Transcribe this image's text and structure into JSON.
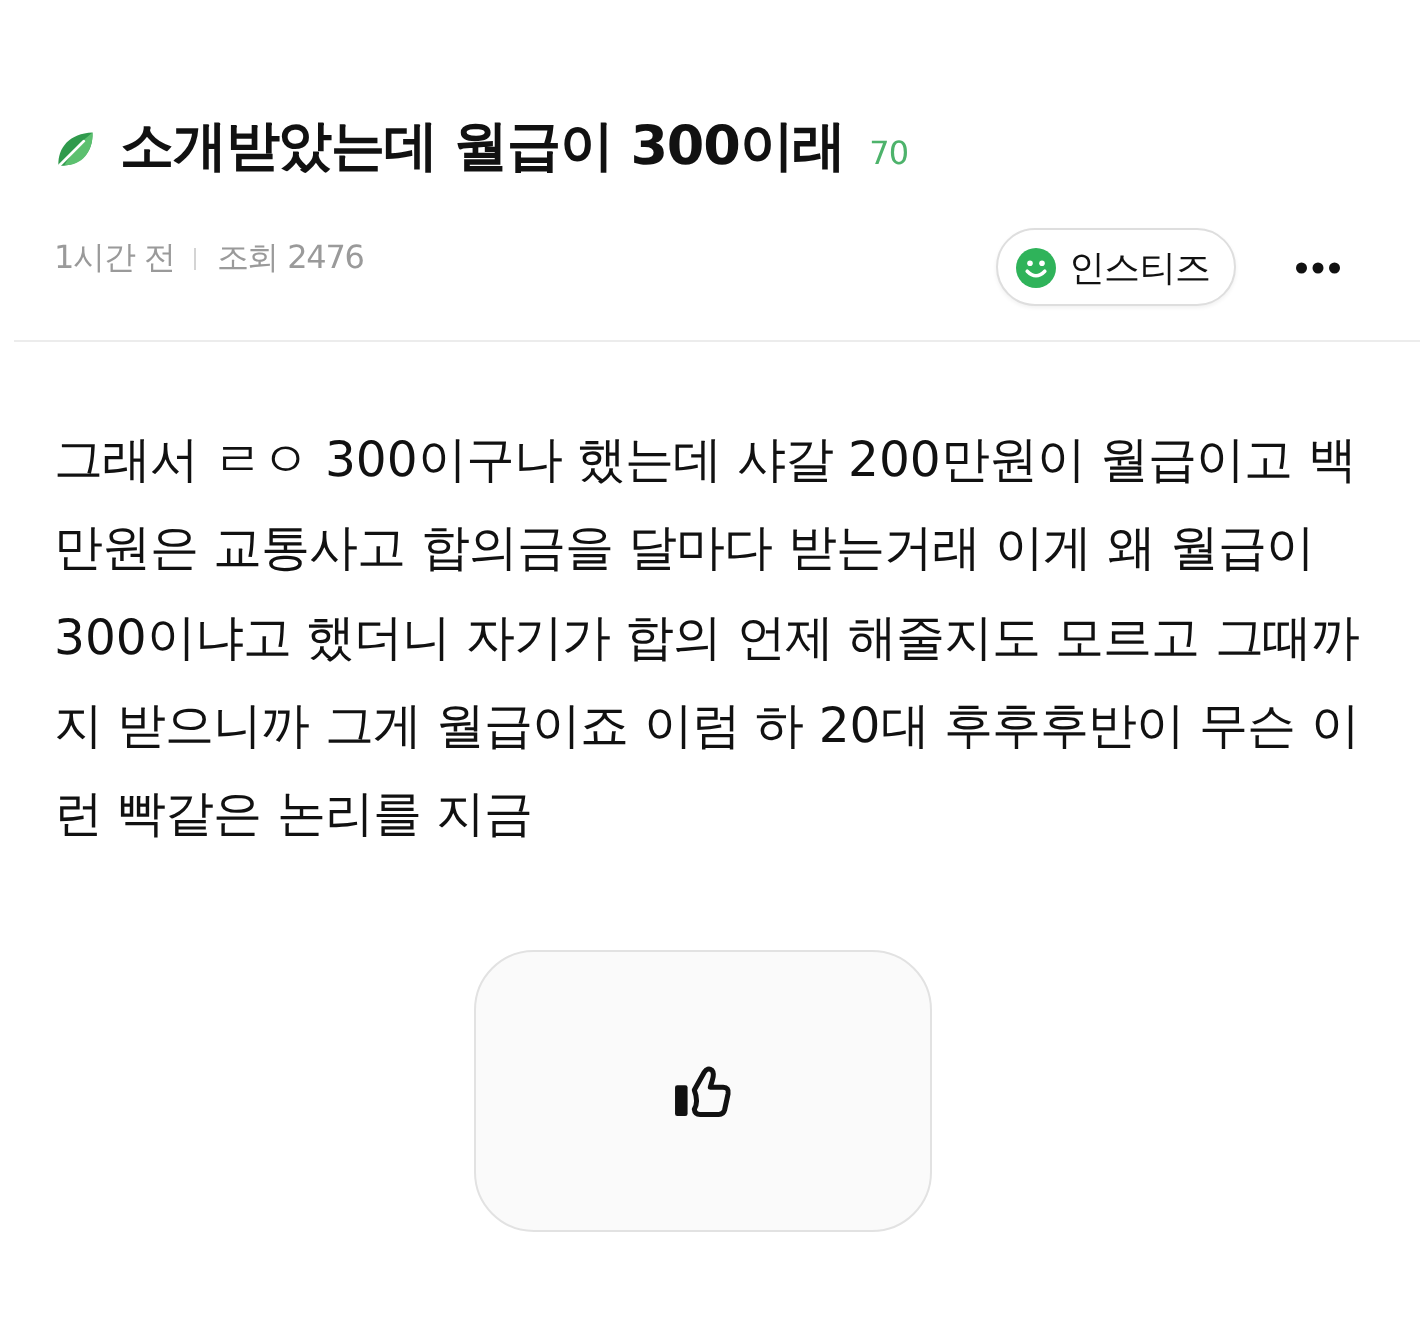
{
  "post": {
    "title": "소개받았는데 월급이 300이래",
    "comment_count": "70",
    "time": "1시간 전",
    "views": "조회 2476",
    "source": "인스티즈"
  },
  "body": "그래서 ㄹㅇ 300이구나 했는데 샤갈 200만원이 월급이고 백만원은 교통사고 합의금을 달마다 받는거래 이게 왜 월급이 300이냐고 했더니 자기가 합의 언제 해줄지도 모르고 그때까지 받으니까 그게 월급이죠 이럼 하 20대 후후후반이 무슨 이런 빡같은 논리를 지금"
}
